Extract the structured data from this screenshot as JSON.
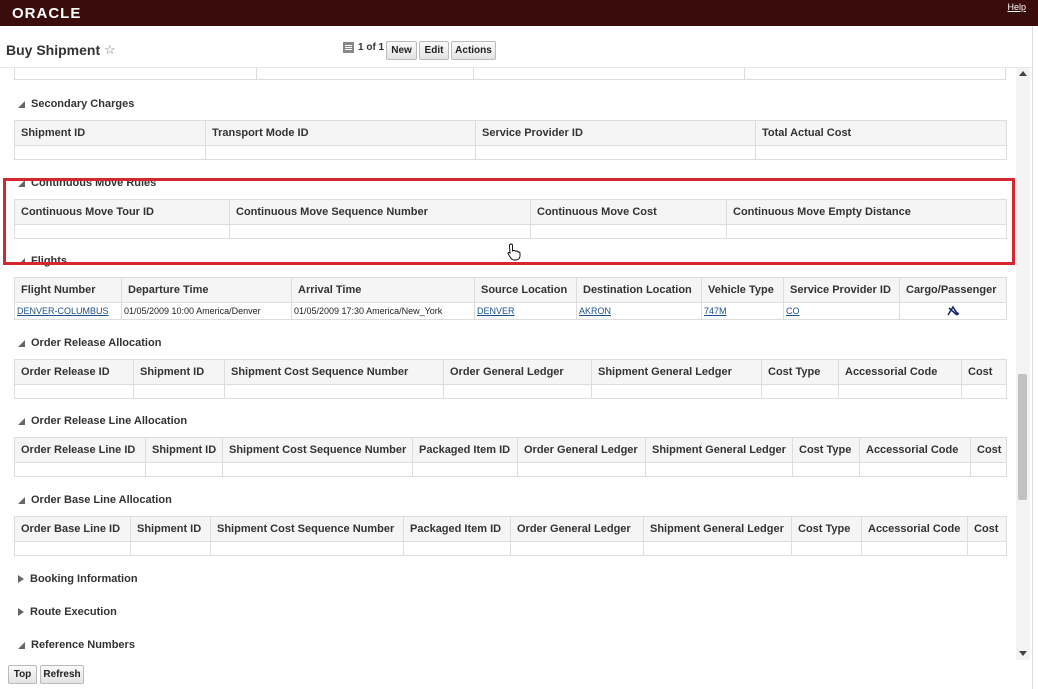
{
  "brand": {
    "logo": "ORACLE",
    "help": "Help"
  },
  "header": {
    "title": "Buy Shipment",
    "pager": "1 of 1",
    "buttons": {
      "new": "New",
      "edit": "Edit",
      "actions": "Actions"
    }
  },
  "sections": {
    "secondary_charges": {
      "title": "Secondary Charges",
      "columns": [
        "Shipment ID",
        "Transport Mode ID",
        "Service Provider ID",
        "Total Actual Cost"
      ]
    },
    "continuous_move": {
      "title": "Continuous Move Rules",
      "columns": [
        "Continuous Move Tour ID",
        "Continuous Move Sequence Number",
        "Continuous Move Cost",
        "Continuous Move Empty Distance"
      ]
    },
    "flights": {
      "title": "Flights",
      "columns": [
        "Flight Number",
        "Departure Time",
        "Arrival Time",
        "Source Location",
        "Destination Location",
        "Vehicle Type",
        "Service Provider ID",
        "Cargo/Passenger"
      ],
      "row": {
        "flight_number": "DENVER-COLUMBUS",
        "departure": "01/05/2009 10:00 America/Denver",
        "arrival": "01/05/2009 17:30 America/New_York",
        "source": "DENVER",
        "destination": "AKRON",
        "vehicle": "747M",
        "provider": "CO",
        "cargo_icon": "cargo-passenger-icon"
      }
    },
    "order_release_allocation": {
      "title": "Order Release Allocation",
      "columns": [
        "Order Release ID",
        "Shipment ID",
        "Shipment Cost Sequence Number",
        "Order General Ledger",
        "Shipment General Ledger",
        "Cost Type",
        "Accessorial Code",
        "Cost"
      ]
    },
    "order_release_line_allocation": {
      "title": "Order Release Line Allocation",
      "columns": [
        "Order Release Line ID",
        "Shipment ID",
        "Shipment Cost Sequence Number",
        "Packaged Item ID",
        "Order General Ledger",
        "Shipment General Ledger",
        "Cost Type",
        "Accessorial Code",
        "Cost"
      ]
    },
    "order_base_line_allocation": {
      "title": "Order Base Line Allocation",
      "columns": [
        "Order Base Line ID",
        "Shipment ID",
        "Shipment Cost Sequence Number",
        "Packaged Item ID",
        "Order General Ledger",
        "Shipment General Ledger",
        "Cost Type",
        "Accessorial Code",
        "Cost"
      ]
    },
    "booking_information": {
      "title": "Booking Information"
    },
    "route_execution": {
      "title": "Route Execution"
    },
    "reference_numbers": {
      "title": "Reference Numbers"
    }
  },
  "footer": {
    "top": "Top",
    "refresh": "Refresh"
  },
  "colors": {
    "brand_bar": "#3a0c0c",
    "highlight": "#d7262f",
    "link": "#1a4f8a"
  }
}
